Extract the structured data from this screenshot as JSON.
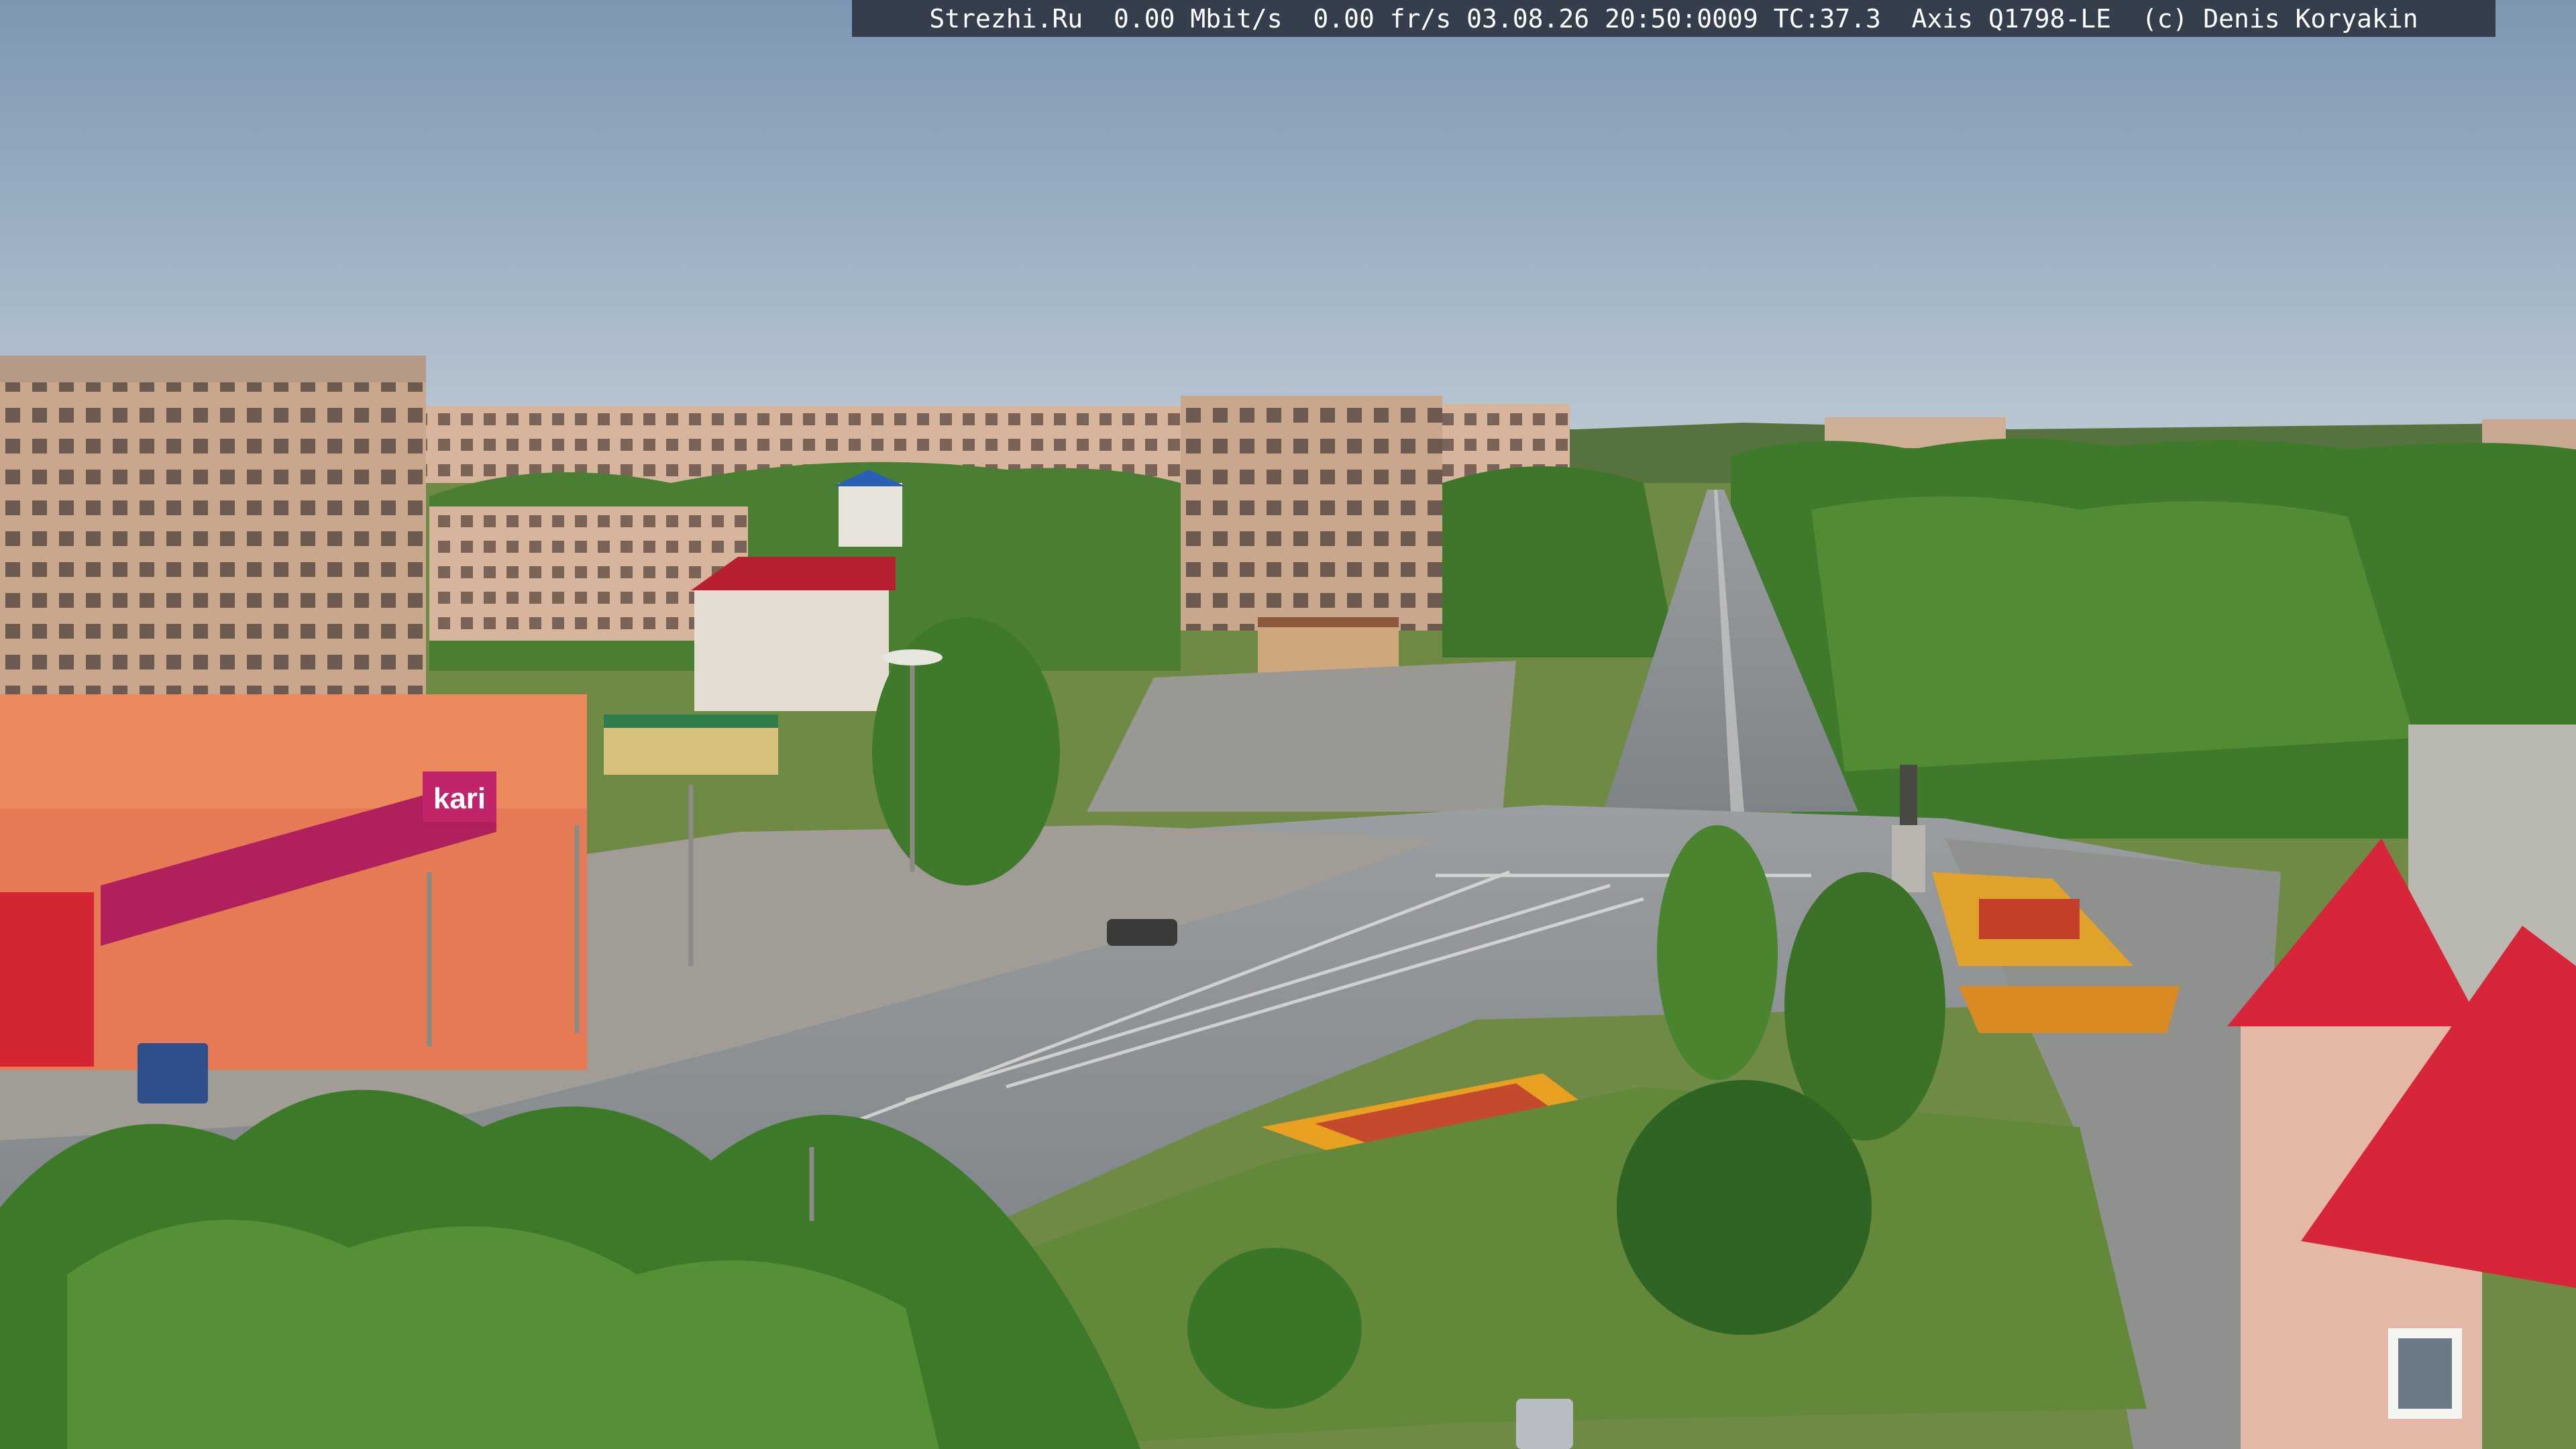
{
  "camera_overlay": {
    "text": "Strezhi.Ru  0.00 Mbit/s  0.00 fr/s 03.08.26 20:50:0009 TC:37.3  Axis Q1798-LE  (c) Denis Koryakin"
  },
  "storefront": {
    "brand_sign": "kari"
  },
  "colors": {
    "sky_top": "#7f98b3",
    "sky_bottom": "#b8c7d3",
    "tree_green": "#3f7a2c",
    "road_gray": "#8c9296",
    "roof_red": "#d7263a",
    "kari_magenta": "#b0205c",
    "flowerbed_orange": "#e8a020"
  }
}
